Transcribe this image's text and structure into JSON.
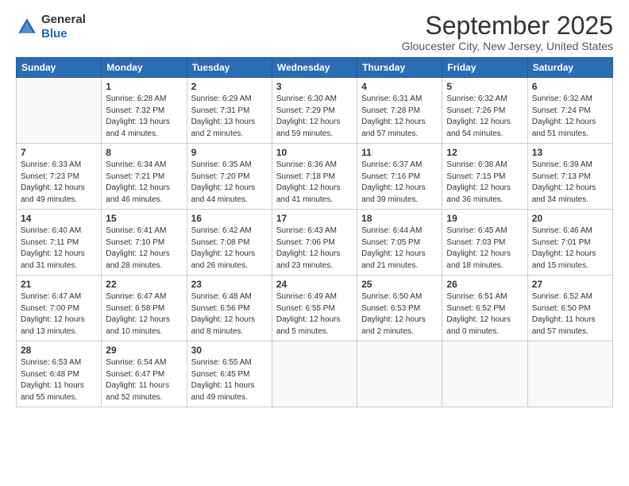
{
  "logo": {
    "general": "General",
    "blue": "Blue"
  },
  "header": {
    "month": "September 2025",
    "location": "Gloucester City, New Jersey, United States"
  },
  "weekdays": [
    "Sunday",
    "Monday",
    "Tuesday",
    "Wednesday",
    "Thursday",
    "Friday",
    "Saturday"
  ],
  "weeks": [
    [
      {
        "day": "",
        "info": ""
      },
      {
        "day": "1",
        "info": "Sunrise: 6:28 AM\nSunset: 7:32 PM\nDaylight: 13 hours\nand 4 minutes."
      },
      {
        "day": "2",
        "info": "Sunrise: 6:29 AM\nSunset: 7:31 PM\nDaylight: 13 hours\nand 2 minutes."
      },
      {
        "day": "3",
        "info": "Sunrise: 6:30 AM\nSunset: 7:29 PM\nDaylight: 12 hours\nand 59 minutes."
      },
      {
        "day": "4",
        "info": "Sunrise: 6:31 AM\nSunset: 7:28 PM\nDaylight: 12 hours\nand 57 minutes."
      },
      {
        "day": "5",
        "info": "Sunrise: 6:32 AM\nSunset: 7:26 PM\nDaylight: 12 hours\nand 54 minutes."
      },
      {
        "day": "6",
        "info": "Sunrise: 6:32 AM\nSunset: 7:24 PM\nDaylight: 12 hours\nand 51 minutes."
      }
    ],
    [
      {
        "day": "7",
        "info": "Sunrise: 6:33 AM\nSunset: 7:23 PM\nDaylight: 12 hours\nand 49 minutes."
      },
      {
        "day": "8",
        "info": "Sunrise: 6:34 AM\nSunset: 7:21 PM\nDaylight: 12 hours\nand 46 minutes."
      },
      {
        "day": "9",
        "info": "Sunrise: 6:35 AM\nSunset: 7:20 PM\nDaylight: 12 hours\nand 44 minutes."
      },
      {
        "day": "10",
        "info": "Sunrise: 6:36 AM\nSunset: 7:18 PM\nDaylight: 12 hours\nand 41 minutes."
      },
      {
        "day": "11",
        "info": "Sunrise: 6:37 AM\nSunset: 7:16 PM\nDaylight: 12 hours\nand 39 minutes."
      },
      {
        "day": "12",
        "info": "Sunrise: 6:38 AM\nSunset: 7:15 PM\nDaylight: 12 hours\nand 36 minutes."
      },
      {
        "day": "13",
        "info": "Sunrise: 6:39 AM\nSunset: 7:13 PM\nDaylight: 12 hours\nand 34 minutes."
      }
    ],
    [
      {
        "day": "14",
        "info": "Sunrise: 6:40 AM\nSunset: 7:11 PM\nDaylight: 12 hours\nand 31 minutes."
      },
      {
        "day": "15",
        "info": "Sunrise: 6:41 AM\nSunset: 7:10 PM\nDaylight: 12 hours\nand 28 minutes."
      },
      {
        "day": "16",
        "info": "Sunrise: 6:42 AM\nSunset: 7:08 PM\nDaylight: 12 hours\nand 26 minutes."
      },
      {
        "day": "17",
        "info": "Sunrise: 6:43 AM\nSunset: 7:06 PM\nDaylight: 12 hours\nand 23 minutes."
      },
      {
        "day": "18",
        "info": "Sunrise: 6:44 AM\nSunset: 7:05 PM\nDaylight: 12 hours\nand 21 minutes."
      },
      {
        "day": "19",
        "info": "Sunrise: 6:45 AM\nSunset: 7:03 PM\nDaylight: 12 hours\nand 18 minutes."
      },
      {
        "day": "20",
        "info": "Sunrise: 6:46 AM\nSunset: 7:01 PM\nDaylight: 12 hours\nand 15 minutes."
      }
    ],
    [
      {
        "day": "21",
        "info": "Sunrise: 6:47 AM\nSunset: 7:00 PM\nDaylight: 12 hours\nand 13 minutes."
      },
      {
        "day": "22",
        "info": "Sunrise: 6:47 AM\nSunset: 6:58 PM\nDaylight: 12 hours\nand 10 minutes."
      },
      {
        "day": "23",
        "info": "Sunrise: 6:48 AM\nSunset: 6:56 PM\nDaylight: 12 hours\nand 8 minutes."
      },
      {
        "day": "24",
        "info": "Sunrise: 6:49 AM\nSunset: 6:55 PM\nDaylight: 12 hours\nand 5 minutes."
      },
      {
        "day": "25",
        "info": "Sunrise: 6:50 AM\nSunset: 6:53 PM\nDaylight: 12 hours\nand 2 minutes."
      },
      {
        "day": "26",
        "info": "Sunrise: 6:51 AM\nSunset: 6:52 PM\nDaylight: 12 hours\nand 0 minutes."
      },
      {
        "day": "27",
        "info": "Sunrise: 6:52 AM\nSunset: 6:50 PM\nDaylight: 11 hours\nand 57 minutes."
      }
    ],
    [
      {
        "day": "28",
        "info": "Sunrise: 6:53 AM\nSunset: 6:48 PM\nDaylight: 11 hours\nand 55 minutes."
      },
      {
        "day": "29",
        "info": "Sunrise: 6:54 AM\nSunset: 6:47 PM\nDaylight: 11 hours\nand 52 minutes."
      },
      {
        "day": "30",
        "info": "Sunrise: 6:55 AM\nSunset: 6:45 PM\nDaylight: 11 hours\nand 49 minutes."
      },
      {
        "day": "",
        "info": ""
      },
      {
        "day": "",
        "info": ""
      },
      {
        "day": "",
        "info": ""
      },
      {
        "day": "",
        "info": ""
      }
    ]
  ]
}
